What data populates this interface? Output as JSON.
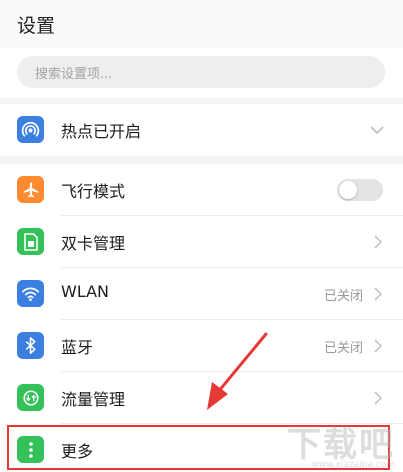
{
  "header": {
    "title": "设置"
  },
  "search": {
    "placeholder": "搜索设置项..."
  },
  "items": [
    {
      "label": "热点已开启",
      "icon": "hotspot-icon",
      "color": "#3b7fe0",
      "accessory": "chevron-down"
    },
    {
      "label": "飞行模式",
      "icon": "airplane-icon",
      "color": "#ff8a30",
      "accessory": "toggle",
      "toggle_on": false
    },
    {
      "label": "双卡管理",
      "icon": "sim-card-icon",
      "color": "#35c15a",
      "accessory": "chevron-right"
    },
    {
      "label": "WLAN",
      "icon": "wifi-icon",
      "color": "#3b7fe0",
      "accessory": "chevron-right",
      "status": "已关闭"
    },
    {
      "label": "蓝牙",
      "icon": "bluetooth-icon",
      "color": "#3b7fe0",
      "accessory": "chevron-right",
      "status": "已关闭"
    },
    {
      "label": "流量管理",
      "icon": "data-usage-icon",
      "color": "#35c15a",
      "accessory": "chevron-right"
    },
    {
      "label": "更多",
      "icon": "more-icon",
      "color": "#35c15a",
      "accessory": "none"
    }
  ],
  "annotation": {
    "color": "#e53935"
  },
  "watermark": {
    "main": "下载吧",
    "sub": "www.xiazaiba.com"
  }
}
